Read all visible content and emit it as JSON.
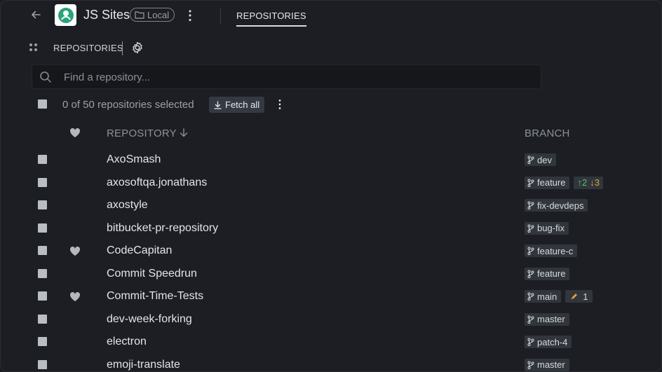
{
  "header": {
    "title": "JS Sites",
    "local_badge": "Local",
    "tab": "REPOSITORIES"
  },
  "toolbar": {
    "section_label": "REPOSITORIES"
  },
  "search": {
    "placeholder": "Find a repository..."
  },
  "selection": {
    "text": "0 of 50 repositories selected",
    "fetch_label": "Fetch all"
  },
  "columns": {
    "repository": "REPOSITORY",
    "branch": "BRANCH"
  },
  "colors": {
    "ahead": "#56c26b",
    "behind": "#e0a23a",
    "accent_logo": "#2aa37a"
  },
  "repos": [
    {
      "name": "AxoSmash",
      "fav": false,
      "branch": "dev"
    },
    {
      "name": "axosoftqa.jonathans",
      "fav": false,
      "branch": "feature",
      "ahead": "2",
      "behind": "3"
    },
    {
      "name": "axostyle",
      "fav": false,
      "branch": "fix-devdeps"
    },
    {
      "name": "bitbucket-pr-repository",
      "fav": false,
      "branch": "bug-fix"
    },
    {
      "name": "CodeCapitan",
      "fav": true,
      "branch": "feature-c"
    },
    {
      "name": "Commit Speedrun",
      "fav": false,
      "branch": "feature"
    },
    {
      "name": "Commit-Time-Tests",
      "fav": true,
      "branch": "main",
      "wip": "1"
    },
    {
      "name": "dev-week-forking",
      "fav": false,
      "branch": "master"
    },
    {
      "name": "electron",
      "fav": false,
      "branch": "patch-4"
    },
    {
      "name": "emoji-translate",
      "fav": false,
      "branch": "master"
    }
  ]
}
